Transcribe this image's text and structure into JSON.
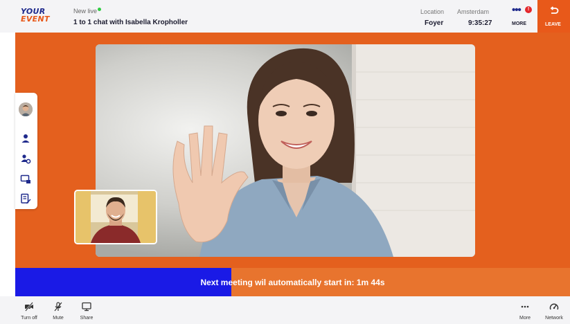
{
  "header": {
    "logo_line1": "YOUR",
    "logo_line2": "EVENT",
    "session_subtitle": "New live",
    "session_title": "1 to 1 chat with Isabella Kropholler",
    "location_label": "Location",
    "location_value": "Foyer",
    "city_label": "Amsterdam",
    "time_value": "9:35:27",
    "more_dots": "•••",
    "more_badge": "!",
    "more_label": "MORE",
    "leave_label": "LEAVE"
  },
  "sidebar": {
    "icons": [
      "user-avatar",
      "person-icon",
      "person-settings-icon",
      "screen-share-icon",
      "notes-icon"
    ]
  },
  "countdown": {
    "text": "Next meeting wil automatically start in: 1m 44s",
    "progress_fraction": 0.39,
    "fill_color": "#1a1ae6",
    "track_color": "#e8742e"
  },
  "footer": {
    "left": [
      {
        "icon": "video-off-icon",
        "label": "Turn off"
      },
      {
        "icon": "mic-off-icon",
        "label": "Mute"
      },
      {
        "icon": "monitor-icon",
        "label": "Share"
      }
    ],
    "right": [
      {
        "icon": "more-dots-icon",
        "label": "More"
      },
      {
        "icon": "network-gauge-icon",
        "label": "Network"
      }
    ]
  },
  "colors": {
    "accent_orange": "#e8591a",
    "brand_navy": "#1f2a8c",
    "stage_orange": "#e4601e"
  }
}
